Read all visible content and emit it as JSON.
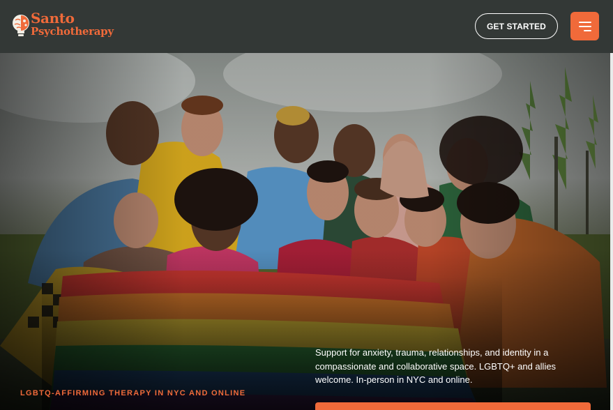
{
  "brand": {
    "name_line1": "Santo",
    "name_line2": "Psychotherapy",
    "logo_icon": "brain-lightbulb-icon",
    "accent_color": "#f06a3a",
    "header_bg": "#333836"
  },
  "header": {
    "cta_label": "GET STARTED",
    "menu_icon": "hamburger-menu-icon"
  },
  "hero": {
    "image_subject": "group-photo",
    "description": "Support for anxiety, trauma, relationships, and identity in a compassionate and collaborative space. LGBTQ+ and allies welcome. In-person in NYC and online.",
    "eyebrow": "LGBTQ-AFFIRMING THERAPY IN NYC AND ONLINE"
  }
}
